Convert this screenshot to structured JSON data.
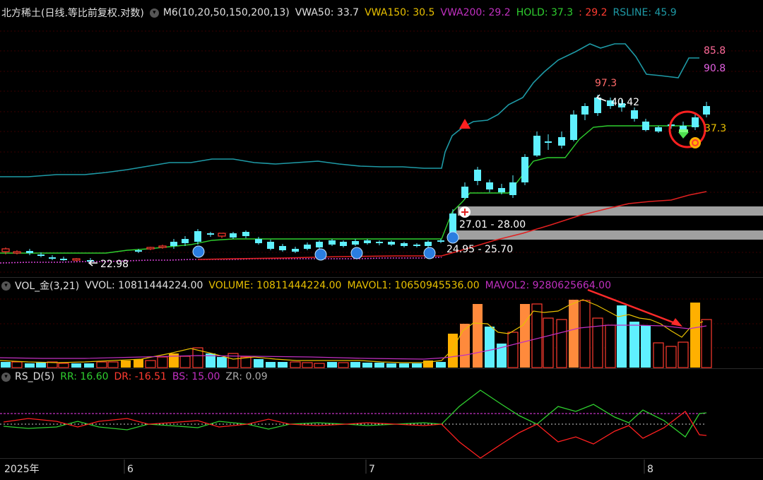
{
  "main": {
    "title": "北方稀土(日线.等比前复权.对数)",
    "indicator": "M6(10,20,50,150,200,13)",
    "vwa50": "VWA50: 33.7",
    "vwa150": "VWA150: 30.5",
    "vwa200": "VWA200: 29.2",
    "hold_a": "HOLD: 37.3",
    "hold_b": ": 29.2",
    "rsline": "RSLINE: 45.9",
    "labels": {
      "low_price": "22.98",
      "zone1": "27.01 - 28.00",
      "zone2": "24.95 - 25.70",
      "high_price": "40.42",
      "rs_top": "85.8",
      "rs_val": "90.8",
      "hold_val": "37.3",
      "rs_peak": "97.3"
    }
  },
  "volume": {
    "title": "VOL_金(3,21)",
    "vvol": "VVOL: 10811444224.00",
    "volume": "VOLUME: 10811444224.00",
    "mavol1": "MAVOL1: 10650945536.00",
    "mavol2": "MAVOL2: 9280625664.00"
  },
  "rsd": {
    "title": "RS_D(5)",
    "rr": "RR: 16.60",
    "dr": "DR: -16.51",
    "bs": "BS: 15.00",
    "zr": "ZR: 0.09"
  },
  "xaxis": [
    "2025年",
    "6",
    "7",
    "8"
  ],
  "colors": {
    "up": "#ff3b30",
    "down": "#5ff0ff",
    "hold": "#2fcf2f",
    "rs": "#1e9aa6",
    "vwa200": "#d040d0",
    "vol_yellow": "#ffb000",
    "vol_orange": "#ff8a3c",
    "bg": "#000000"
  },
  "icons": [
    "circle-caret-icon",
    "blue-ball-icon",
    "plus-icon",
    "red-triangle-icon",
    "gem-icon",
    "arrow-icon"
  ]
}
